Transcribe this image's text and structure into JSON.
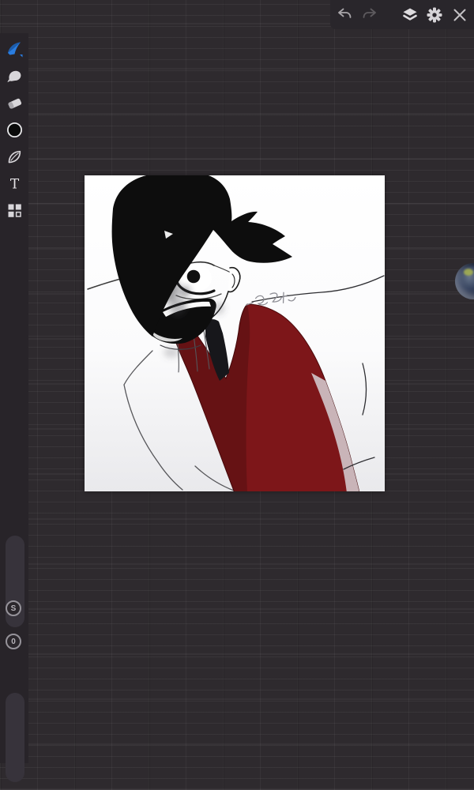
{
  "app": {
    "name": "sketchbook-drawing-app"
  },
  "topbar": {
    "icons": [
      {
        "name": "undo",
        "enabled": true
      },
      {
        "name": "redo",
        "enabled": false
      },
      {
        "name": "layers",
        "enabled": true
      },
      {
        "name": "settings",
        "enabled": true
      },
      {
        "name": "close",
        "enabled": true
      }
    ]
  },
  "sidebar": {
    "tools": [
      {
        "id": "brush",
        "selected": true
      },
      {
        "id": "smudge",
        "selected": false
      },
      {
        "id": "eraser",
        "selected": false
      },
      {
        "id": "color-puck",
        "selected": false
      },
      {
        "id": "lasso-leaf",
        "selected": false
      },
      {
        "id": "text",
        "label": "T",
        "selected": false
      },
      {
        "id": "symmetry-grid",
        "selected": false
      }
    ],
    "slider_buttons": [
      {
        "id": "size",
        "label": "S"
      },
      {
        "id": "opacity",
        "label": "0"
      }
    ]
  },
  "canvas": {
    "artwork": {
      "description": "digital sketch of a grinning character with messy black hair covering one eye, round glasses, black tie, white shirt and dark red vest, body tilted diagonally",
      "signature": "illegible gray handwritten scribble",
      "colors": {
        "hair": "#0d0d0d",
        "skin": "#ffffff",
        "vest": "#7d1619",
        "vest_shadow": "#641013",
        "tie": "#17171b",
        "paper_bottom": "#e9e9ec"
      }
    }
  },
  "colors": {
    "background": "#2e2a2e",
    "panel": "#282429",
    "topbar": "#29262b",
    "accent_blue": "#2a7de1"
  }
}
